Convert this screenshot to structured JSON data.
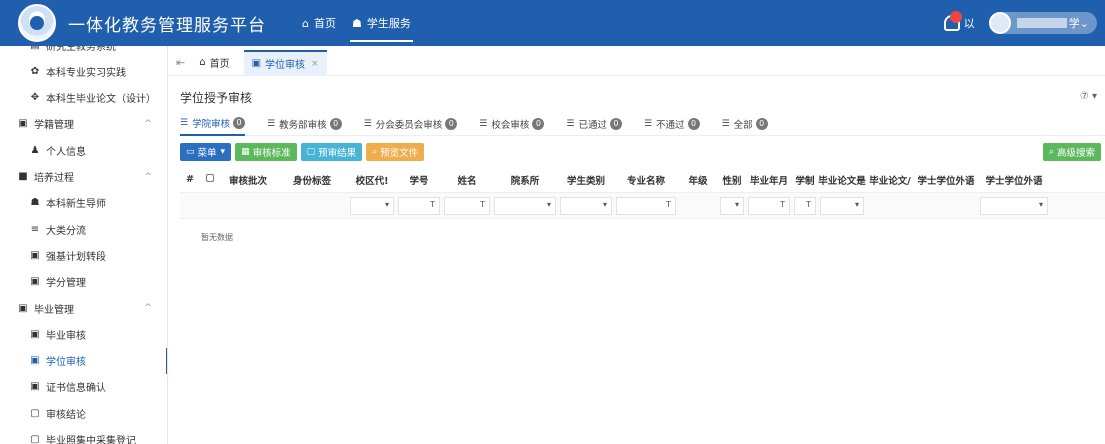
{
  "app": {
    "title": "一体化教务管理服务平台",
    "nav": [
      {
        "icon": "home-icon",
        "glyph": "⌂",
        "label": "首页"
      },
      {
        "icon": "student-icon",
        "glyph": "☗",
        "label": "学生服务"
      }
    ],
    "user_suffix": "学",
    "bell_text": "以"
  },
  "sidebar": {
    "items": [
      {
        "level": 2,
        "icon": "book-icon",
        "glyph": "▤",
        "label": "研究生教务系统"
      },
      {
        "level": 2,
        "icon": "internship-icon",
        "glyph": "✿",
        "label": "本科专业实习实践"
      },
      {
        "level": 2,
        "icon": "thesis-icon",
        "glyph": "✥",
        "label": "本科生毕业论文（设计）"
      },
      {
        "level": 1,
        "icon": "status-icon",
        "glyph": "▣",
        "label": "学籍管理",
        "arrow": "^"
      },
      {
        "level": 2,
        "icon": "person-icon",
        "glyph": "♟",
        "label": "个人信息"
      },
      {
        "level": 1,
        "icon": "training-icon",
        "glyph": "■",
        "label": "培养过程",
        "arrow": "^"
      },
      {
        "level": 2,
        "icon": "mentor-icon",
        "glyph": "☗",
        "label": "本科新生导师"
      },
      {
        "level": 2,
        "icon": "split-icon",
        "glyph": "≡",
        "label": "大类分流"
      },
      {
        "level": 2,
        "icon": "plan-icon",
        "glyph": "▣",
        "label": "强基计划转段"
      },
      {
        "level": 2,
        "icon": "credit-icon",
        "glyph": "▣",
        "label": "学分管理"
      },
      {
        "level": 1,
        "icon": "graduate-icon",
        "glyph": "▣",
        "label": "毕业管理",
        "arrow": "^"
      },
      {
        "level": 2,
        "icon": "grad-review-icon",
        "glyph": "▣",
        "label": "毕业审核"
      },
      {
        "level": 2,
        "icon": "degree-review-icon",
        "glyph": "▣",
        "label": "学位审核",
        "active": true
      },
      {
        "level": 2,
        "icon": "certificate-icon",
        "glyph": "▣",
        "label": "证书信息确认"
      },
      {
        "level": 2,
        "icon": "conclusion-icon",
        "glyph": "▢",
        "label": "审核结论"
      },
      {
        "level": 2,
        "icon": "more-icon",
        "glyph": "▢",
        "label": "毕业照集中采集登记"
      }
    ]
  },
  "tabs": [
    {
      "label": "首页",
      "icon": "home-icon",
      "glyph": "⌂",
      "active": false
    },
    {
      "label": "学位审核",
      "icon": "degree-review-icon",
      "glyph": "▣",
      "active": true,
      "close": "×"
    }
  ],
  "page": {
    "title": "学位授予审核",
    "help": "⑦ ▾"
  },
  "subtabs": [
    {
      "label": "学院审核",
      "count": "0",
      "active": true
    },
    {
      "label": "教务部审核",
      "count": "0"
    },
    {
      "label": "分会委员会审核",
      "count": "0"
    },
    {
      "label": "校会审核",
      "count": "0"
    },
    {
      "label": "已通过",
      "count": "0"
    },
    {
      "label": "不通过",
      "count": "0"
    },
    {
      "label": "全部",
      "count": "0"
    }
  ],
  "toolbar": {
    "menu": "菜单",
    "standard": "审核标准",
    "result": "预审结果",
    "preview": "预览文件",
    "advanced_search": "高级搜索"
  },
  "table": {
    "columns": [
      "#",
      "",
      "审核批次",
      "身份标签",
      "校区代!",
      "学号",
      "姓名",
      "院系所",
      "学生类别",
      "专业名称",
      "年级",
      "性别",
      "毕业年月",
      "学制",
      "毕业论文是",
      "毕业论文/",
      "学士学位外语",
      "学士学位外语"
    ],
    "empty_text": "暂无数据"
  },
  "colors": {
    "primary": "#1f5fae",
    "green": "#5cb85c",
    "teal": "#47b4d6",
    "orange": "#f0ad4e"
  }
}
